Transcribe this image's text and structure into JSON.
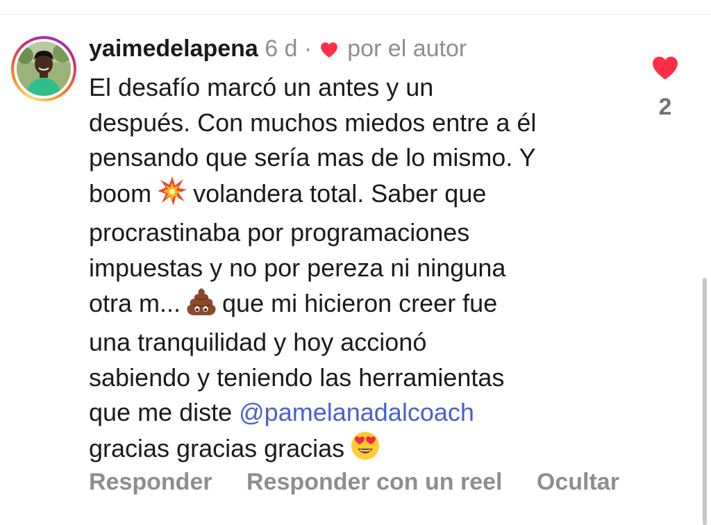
{
  "comment": {
    "username": "yaimedelapena",
    "time": "6 d",
    "separator": "·",
    "liked_by_author": "por el autor",
    "icons": {
      "author_heart": "heart-icon",
      "boom_emoji": "collision-emoji",
      "poop_emoji": "pile-of-poo-emoji",
      "heart_eyes_emoji": "heart-eyes-emoji"
    },
    "lines": {
      "l1": "El desafío marcó un antes y un",
      "l2": "después. Con muchos miedos entre a él",
      "l3": "pensando que sería mas de lo mismo. Y",
      "l4a": "boom",
      "l4b": "volandera total. Saber que",
      "l5": "procrastinaba por programaciones",
      "l6": "impuestas y no por pereza ni ninguna",
      "l7a": "otra m...",
      "l7b": "que mi hicieron creer fue",
      "l8": "una tranquilidad y hoy accionó",
      "l9": "sabiendo y teniendo las herramientas",
      "l10a": "que me diste ",
      "mention": "@pamelanadalcoach",
      "l11": "gracias gracias gracias"
    },
    "actions": {
      "reply": "Responder",
      "reply_reel": "Responder con un reel",
      "hide": "Ocultar"
    },
    "likes": {
      "count": "2",
      "liked": true
    },
    "colors": {
      "heart": "#ff2d48",
      "mention": "#4a5fd1",
      "meta": "#8e8e8e"
    }
  }
}
